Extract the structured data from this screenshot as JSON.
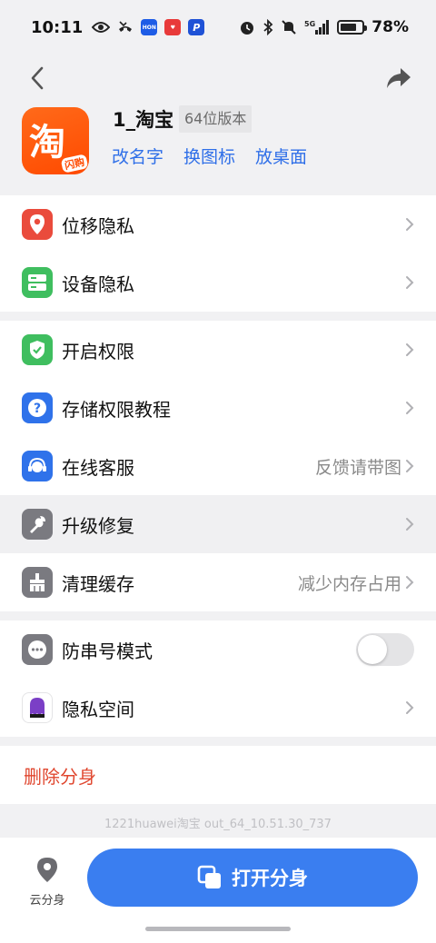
{
  "status_bar": {
    "time": "10:11",
    "battery_percent": "78%",
    "battery_level": 0.78,
    "network": "5G",
    "notif_apps": [
      "HONOR",
      "Love",
      "Pin"
    ]
  },
  "nav": {
    "back_icon": "chevron-left-icon",
    "share_icon": "share-arrow-icon"
  },
  "app": {
    "name": "1_淘宝",
    "badge": "64位版本",
    "icon_glyph": "淘",
    "icon_tag": "闪购",
    "actions": [
      "改名字",
      "换图标",
      "放桌面"
    ]
  },
  "groups": [
    {
      "rows": [
        {
          "label": "位移隐私",
          "icon": "location-pin-icon",
          "color": "#ea4b3c",
          "hint": ""
        },
        {
          "label": "设备隐私",
          "icon": "device-storage-icon",
          "color": "#3fbe5f",
          "hint": ""
        }
      ]
    },
    {
      "rows": [
        {
          "label": "开启权限",
          "icon": "shield-check-icon",
          "color": "#3fbe5f",
          "hint": ""
        },
        {
          "label": "存储权限教程",
          "icon": "question-icon",
          "color": "#2f72ea",
          "hint": ""
        },
        {
          "label": "在线客服",
          "icon": "headset-icon",
          "color": "#2f72ea",
          "hint": "反馈请带图"
        },
        {
          "label": "升级修复",
          "icon": "wrench-icon",
          "color": "#7a7a80",
          "hint": ""
        },
        {
          "label": "清理缓存",
          "icon": "broom-icon",
          "color": "#7a7a80",
          "hint": "减少内存占用"
        }
      ]
    },
    {
      "rows": [
        {
          "label": "防串号模式",
          "icon": "more-dots-icon",
          "color": "#7a7a80",
          "hint": "",
          "toggle": false
        },
        {
          "label": "隐私空间",
          "icon": "ghost-icon",
          "color": "#ffffff",
          "hint": ""
        }
      ]
    }
  ],
  "delete_label": "删除分身",
  "version_text": "1221huawei淘宝 out_64_10.51.30_737",
  "bottom": {
    "cloud_label": "云分身",
    "open_label": "打开分身"
  },
  "colors": {
    "accent": "#3a7ef0",
    "danger": "#e0472f",
    "link": "#2f6fe8"
  }
}
